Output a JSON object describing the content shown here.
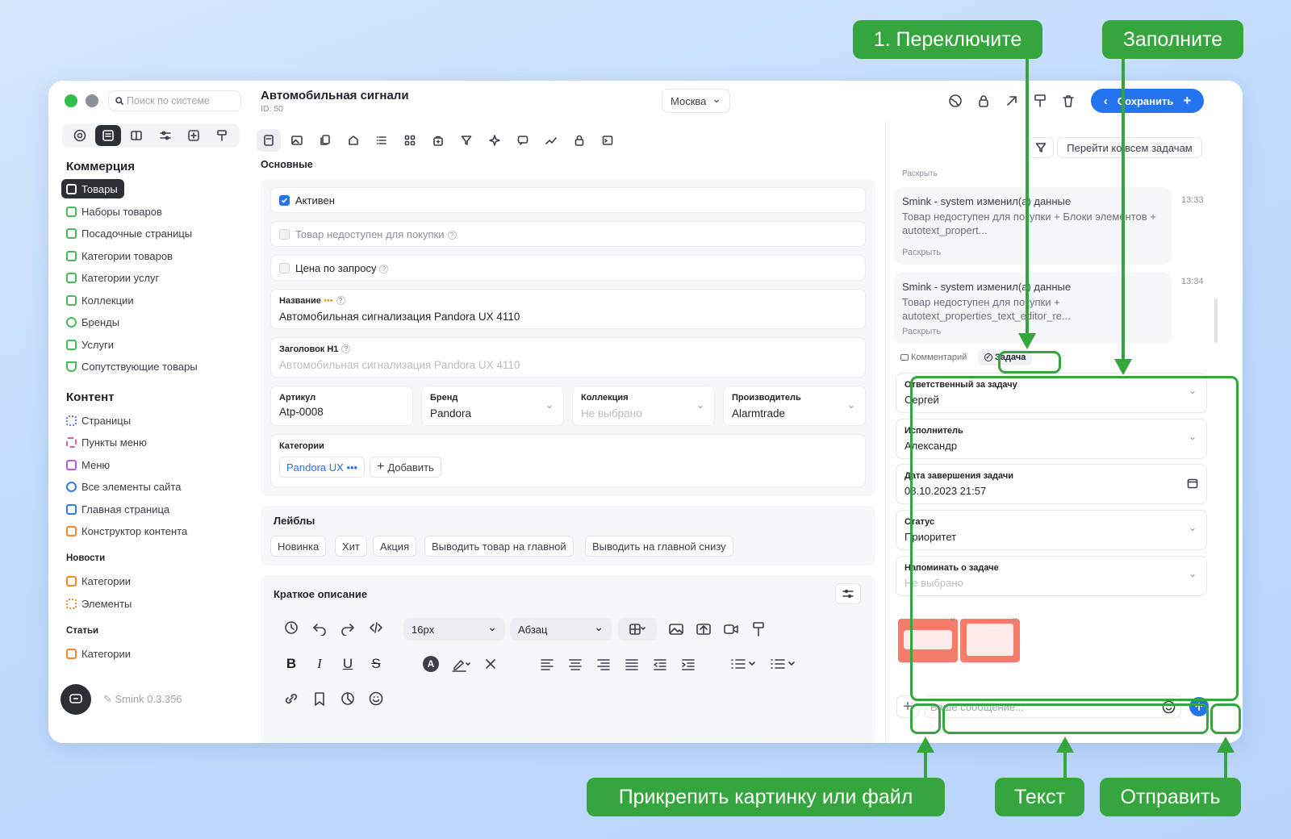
{
  "header": {
    "search_placeholder": "Поиск по системе",
    "title": "Автомобильная сигнали",
    "id": "ID: 50",
    "city": "Москва",
    "save_label": "Сохранить"
  },
  "sidebar": {
    "commerce_title": "Коммерция",
    "commerce": [
      "Товары",
      "Наборы товаров",
      "Посадочные страницы",
      "Категории товаров",
      "Категории услуг",
      "Коллекции",
      "Бренды",
      "Услуги",
      "Сопутствующие товары"
    ],
    "content_title": "Контент",
    "content": [
      "Страницы",
      "Пункты меню",
      "Меню",
      "Все элементы сайта",
      "Главная страница",
      "Конструктор контента"
    ],
    "news_title": "Новости",
    "news": [
      "Категории",
      "Элементы"
    ],
    "articles_title": "Статьи",
    "articles": [
      "Категории"
    ],
    "version": "Smink 0.3.356"
  },
  "main": {
    "section": "Основные",
    "active": "Активен",
    "unavailable": "Товар недоступен для покупки",
    "price_request": "Цена по запросу",
    "name_label": "Название",
    "name_value": "Автомобильная сигнализация Pandora UX 4110",
    "h1_label": "Заголовок H1",
    "h1_placeholder": "Автомобильная сигнализация Pandora UX 4110",
    "article_label": "Артикул",
    "article_value": "Atp-0008",
    "brand_label": "Бренд",
    "brand_value": "Pandora",
    "collection_label": "Коллекция",
    "collection_value": "Не выбрано",
    "maker_label": "Производитель",
    "maker_value": "Alarmtrade",
    "categories_label": "Категории",
    "category_chip": "Pandora UX",
    "add_label": "Добавить",
    "labels_title": "Лейблы",
    "labels": [
      "Новинка",
      "Хит",
      "Акция",
      "Выводить товар на главной",
      "Выводить на главной снизу"
    ],
    "short_desc": "Краткое описание",
    "font_size": "16px",
    "paragraph": "Абзац"
  },
  "right": {
    "all_tasks": "Перейти ко всем задачам",
    "prev_expand": "Раскрыть",
    "messages": [
      {
        "who": "Smink - system изменил(а) данные",
        "text": "Товар недоступен для покупки + Блоки элементов + autotext_propert...",
        "expand": "Раскрыть",
        "time": "13:33"
      },
      {
        "who": "Smink - system изменил(а) данные",
        "text": "Товар недоступен для покупки + autotext_properties_text_editor_re...",
        "expand": "Раскрыть",
        "time": "13:34"
      }
    ],
    "tab_comment": "Комментарий",
    "tab_task": "Задача",
    "task_fields": [
      {
        "label": "Ответственный за задачу",
        "value": "Сергей"
      },
      {
        "label": "Исполнитель",
        "value": "Александр"
      },
      {
        "label": "Дата завершения задачи",
        "value": "08.10.2023 21:57"
      },
      {
        "label": "Статус",
        "value": "Приоритет"
      },
      {
        "label": "Напоминать о задаче",
        "value": "Не выбрано"
      }
    ],
    "message_placeholder": "Ваше сообщение..."
  },
  "callouts": {
    "switch": "1. Переключите",
    "fill": "Заполните",
    "attach": "Прикрепить картинку или файл",
    "text": "Текст",
    "send": "Отправить"
  },
  "colors": {
    "accent": "#2474f0",
    "callout": "#35a53d",
    "dark": "#2b2f36"
  }
}
